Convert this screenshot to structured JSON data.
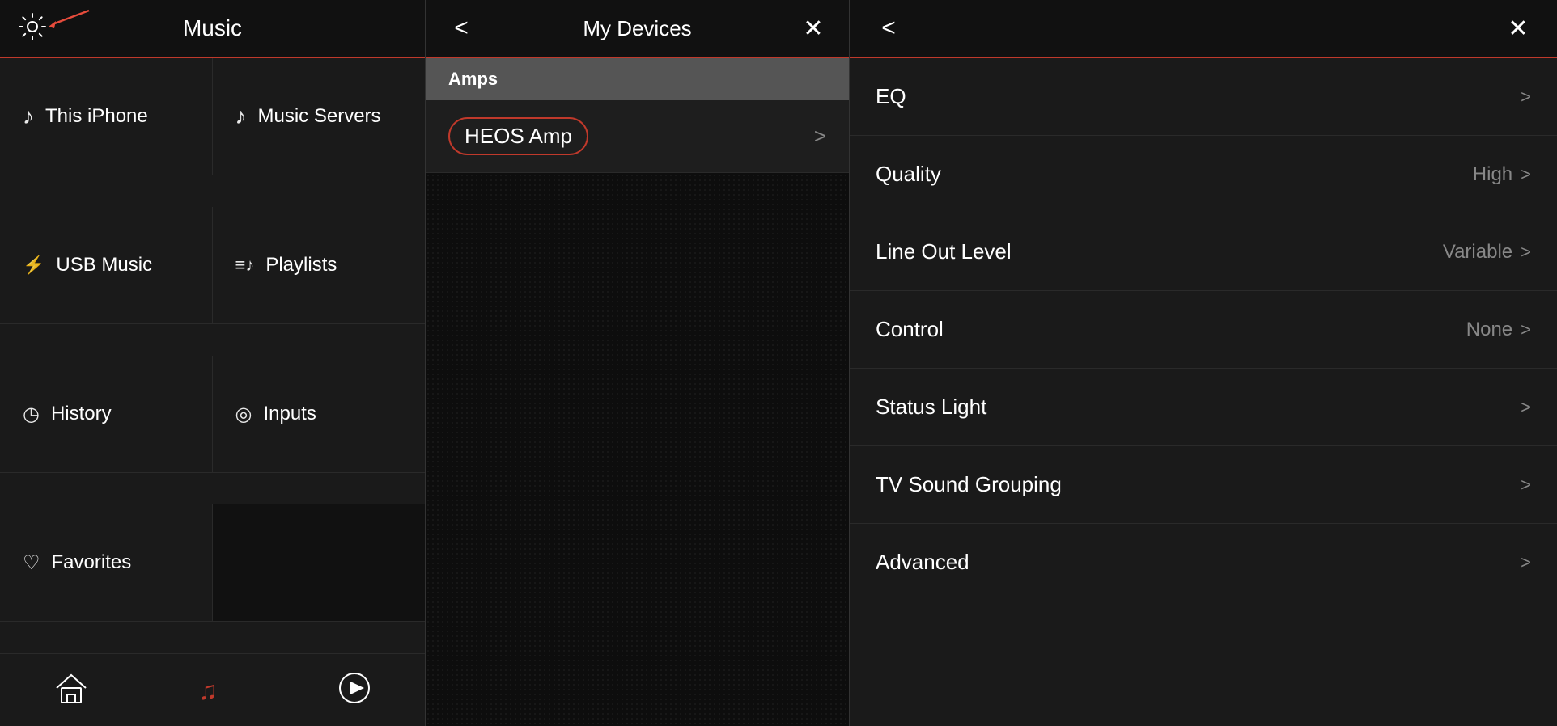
{
  "leftPanel": {
    "header": {
      "title": "Music"
    },
    "gridItems": [
      {
        "id": "this-iphone",
        "icon": "♪",
        "label": "This iPhone",
        "dark": false
      },
      {
        "id": "music-servers",
        "icon": "♪",
        "label": "Music Servers",
        "dark": false
      },
      {
        "id": "usb-music",
        "icon": "usb",
        "label": "USB Music",
        "dark": false
      },
      {
        "id": "playlists",
        "icon": "playlist",
        "label": "Playlists",
        "dark": false
      },
      {
        "id": "history",
        "icon": "history",
        "label": "History",
        "dark": false
      },
      {
        "id": "inputs",
        "icon": "inputs",
        "label": "Inputs",
        "dark": false
      },
      {
        "id": "favorites",
        "icon": "heart",
        "label": "Favorites",
        "dark": false
      },
      {
        "id": "empty",
        "icon": "",
        "label": "",
        "dark": true
      }
    ],
    "nav": {
      "homeLabel": "home",
      "musicLabel": "music",
      "playLabel": "play"
    }
  },
  "middlePanel": {
    "header": {
      "title": "My Devices",
      "backBtn": "<",
      "closeBtn": "×"
    },
    "sections": [
      {
        "label": "Amps",
        "devices": [
          {
            "name": "HEOS Amp",
            "circled": true
          }
        ]
      }
    ]
  },
  "rightPanel": {
    "header": {
      "backBtn": "<",
      "closeBtn": "×"
    },
    "menuItems": [
      {
        "id": "eq",
        "label": "EQ",
        "value": ""
      },
      {
        "id": "quality",
        "label": "Quality",
        "value": "High"
      },
      {
        "id": "line-out-level",
        "label": "Line Out Level",
        "value": "Variable"
      },
      {
        "id": "control",
        "label": "Control",
        "value": "None"
      },
      {
        "id": "status-light",
        "label": "Status Light",
        "value": ""
      },
      {
        "id": "tv-sound-grouping",
        "label": "TV Sound Grouping",
        "value": ""
      },
      {
        "id": "advanced",
        "label": "Advanced",
        "value": ""
      }
    ]
  }
}
